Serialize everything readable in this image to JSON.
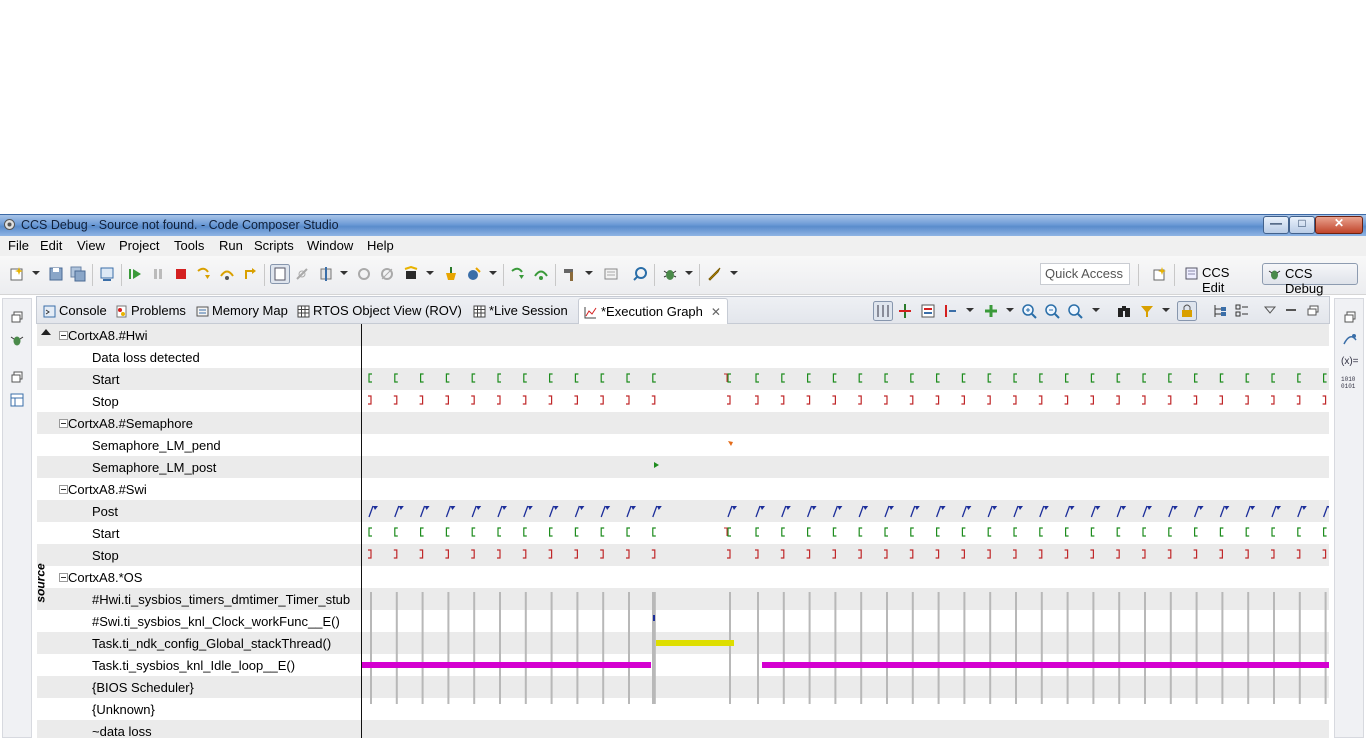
{
  "window": {
    "title": "CCS Debug - Source not found. - Code Composer Studio",
    "minimize_label": "—",
    "maximize_label": "□",
    "close_label": "✕"
  },
  "menu": {
    "items": [
      "File",
      "Edit",
      "View",
      "Project",
      "Tools",
      "Run",
      "Scripts",
      "Window",
      "Help"
    ]
  },
  "toolbar": {
    "quick_access_placeholder": "Quick Access",
    "perspectives": [
      {
        "label": "CCS Edit",
        "icon": "ccs-edit-perspective-icon",
        "active": false
      },
      {
        "label": "CCS Debug",
        "icon": "ccs-debug-perspective-icon",
        "active": true
      }
    ]
  },
  "views": {
    "tabs": [
      {
        "label": "Console",
        "icon": "console-icon",
        "active": false
      },
      {
        "label": "Problems",
        "icon": "problems-icon",
        "active": false
      },
      {
        "label": "Memory Map",
        "icon": "memory-map-icon",
        "active": false
      },
      {
        "label": "RTOS Object View (ROV)",
        "icon": "table-icon",
        "active": false
      },
      {
        "label": "*Live Session",
        "icon": "table-icon",
        "active": false
      },
      {
        "label": "*Execution Graph",
        "icon": "execution-graph-icon",
        "active": true,
        "close": "✕"
      }
    ]
  },
  "graph": {
    "source_label": "source",
    "rows": [
      {
        "label": "CortxA8.#Hwi",
        "group": true
      },
      {
        "label": "Data loss detected"
      },
      {
        "label": "Start"
      },
      {
        "label": "Stop"
      },
      {
        "label": "CortxA8.#Semaphore",
        "group": true
      },
      {
        "label": "Semaphore_LM_pend"
      },
      {
        "label": "Semaphore_LM_post"
      },
      {
        "label": "CortxA8.#Swi",
        "group": true
      },
      {
        "label": "Post"
      },
      {
        "label": "Start"
      },
      {
        "label": "Stop"
      },
      {
        "label": "CortxA8.*OS",
        "group": true
      },
      {
        "label": "#Hwi.ti_sysbios_timers_dmtimer_Timer_stub"
      },
      {
        "label": "#Swi.ti_sysbios_knl_Clock_workFunc__E()"
      },
      {
        "label": "Task.ti_ndk_config_Global_stackThread()"
      },
      {
        "label": "Task.ti_sysbios_knl_Idle_loop__E()"
      },
      {
        "label": "{BIOS Scheduler}"
      },
      {
        "label": "{Unknown}"
      },
      {
        "label": "~data loss"
      }
    ],
    "colors": {
      "start_marker": "#1e8c1e",
      "stop_marker": "#c0282a",
      "post_flag": "#1c2e9a",
      "pend_marker": "#e46c1a",
      "idle_bar": "#d400d0",
      "stack_thread_bar": "#dede00",
      "tick": "#b8b8b8"
    }
  }
}
